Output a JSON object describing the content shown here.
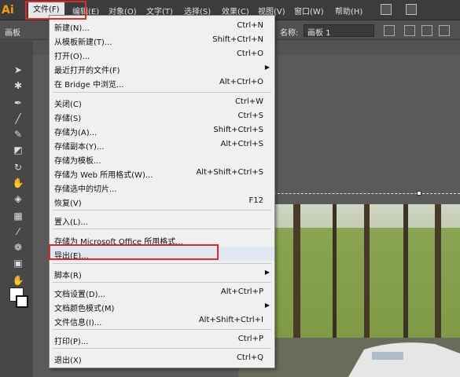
{
  "app": {
    "logo": "Ai"
  },
  "menubar": {
    "items": [
      {
        "label": "文件(F)",
        "active": true
      },
      {
        "label": "编辑(E)"
      },
      {
        "label": "对象(O)"
      },
      {
        "label": "文字(T)"
      },
      {
        "label": "选择(S)"
      },
      {
        "label": "效果(C)"
      },
      {
        "label": "视图(V)"
      },
      {
        "label": "窗口(W)"
      },
      {
        "label": "帮助(H)"
      }
    ]
  },
  "controlbar": {
    "left_label": "画板",
    "name_label": "名称:",
    "name_value": "画板 1"
  },
  "file_menu": {
    "items": [
      {
        "label": "新建(N)...",
        "shortcut": "Ctrl+N"
      },
      {
        "label": "从模板新建(T)...",
        "shortcut": "Shift+Ctrl+N"
      },
      {
        "label": "打开(O)...",
        "shortcut": "Ctrl+O"
      },
      {
        "label": "最近打开的文件(F)",
        "shortcut": "",
        "submenu": true
      },
      {
        "label": "在 Bridge 中浏览...",
        "shortcut": "Alt+Ctrl+O"
      },
      {
        "label": "关闭(C)",
        "shortcut": "Ctrl+W"
      },
      {
        "label": "存储(S)",
        "shortcut": "Ctrl+S"
      },
      {
        "label": "存储为(A)...",
        "shortcut": "Shift+Ctrl+S"
      },
      {
        "label": "存储副本(Y)...",
        "shortcut": "Alt+Ctrl+S"
      },
      {
        "label": "存储为模板...",
        "shortcut": ""
      },
      {
        "label": "存储为 Web 所用格式(W)...",
        "shortcut": "Alt+Shift+Ctrl+S"
      },
      {
        "label": "存储选中的切片...",
        "shortcut": ""
      },
      {
        "label": "恢复(V)",
        "shortcut": "F12"
      },
      {
        "label": "置入(L)...",
        "shortcut": ""
      },
      {
        "label": "存储为 Microsoft Office 所用格式...",
        "shortcut": ""
      },
      {
        "label": "导出(E)...",
        "shortcut": "",
        "highlighted": true
      },
      {
        "label": "脚本(R)",
        "shortcut": "",
        "submenu": true
      },
      {
        "label": "文档设置(D)...",
        "shortcut": "Alt+Ctrl+P"
      },
      {
        "label": "文档颜色模式(M)",
        "shortcut": "",
        "submenu": true
      },
      {
        "label": "文件信息(I)...",
        "shortcut": "Alt+Shift+Ctrl+I"
      },
      {
        "label": "打印(P)...",
        "shortcut": "Ctrl+P"
      },
      {
        "label": "退出(X)",
        "shortcut": "Ctrl+Q"
      }
    ]
  },
  "colors": {
    "highlight_border": "#e02a2a",
    "menu_bg": "#f0f0f0",
    "ui_dark": "#3c3c3c",
    "logo": "#ff9a00"
  }
}
